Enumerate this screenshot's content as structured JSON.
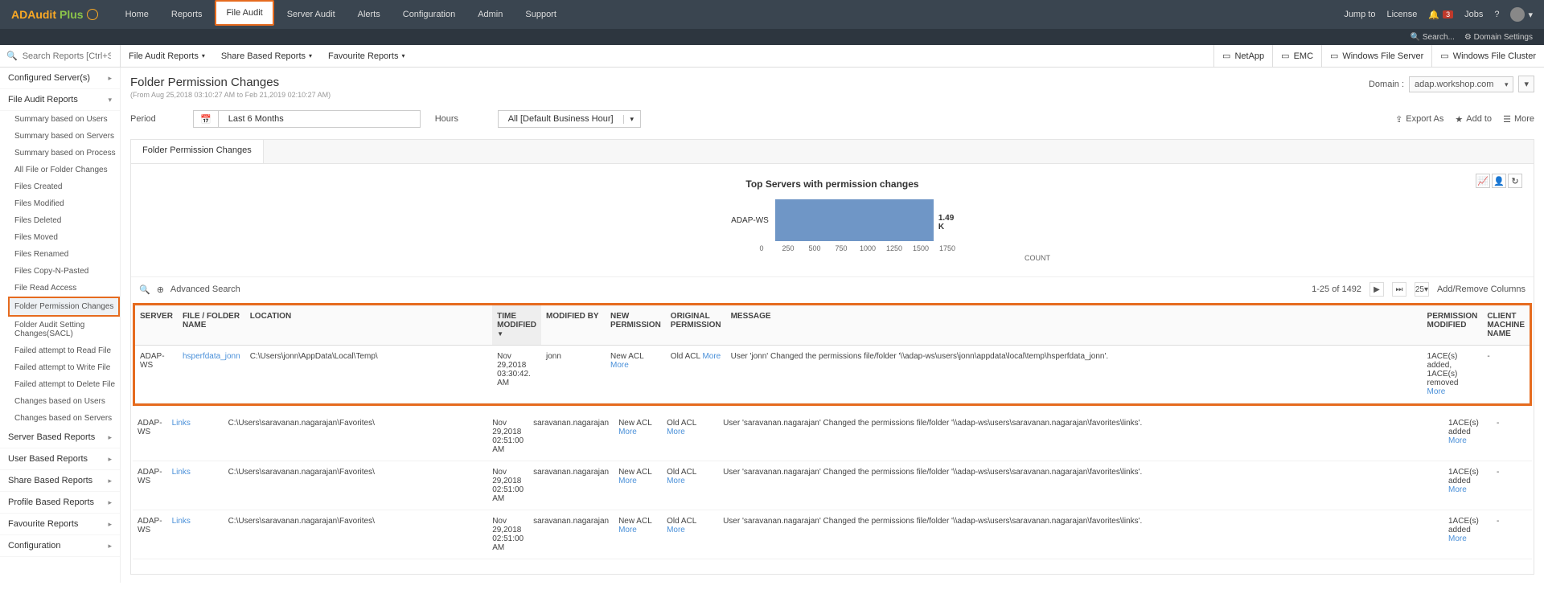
{
  "brand": {
    "p1": "ADAudit",
    "p2": "Plus"
  },
  "topnav": [
    "Home",
    "Reports",
    "File Audit",
    "Server Audit",
    "Alerts",
    "Configuration",
    "Admin",
    "Support"
  ],
  "topnav_active": 2,
  "topright": {
    "jumpto": "Jump to",
    "license": "License",
    "jobs": "Jobs",
    "alerts": "3",
    "search": "Search...",
    "domain_settings": "Domain Settings"
  },
  "second": {
    "search_placeholder": "Search Reports [Ctrl+Space]",
    "subs": [
      "File Audit Reports",
      "Share Based Reports",
      "Favourite Reports"
    ],
    "right": [
      "NetApp",
      "EMC",
      "Windows File Server",
      "Windows File Cluster"
    ]
  },
  "sidebar": {
    "groups": [
      {
        "title": "Configured Server(s)",
        "expand": false
      },
      {
        "title": "File Audit Reports",
        "expand": true,
        "items": [
          "Summary based on Users",
          "Summary based on Servers",
          "Summary based on Process",
          "All File or Folder Changes",
          "Files Created",
          "Files Modified",
          "Files Deleted",
          "Files Moved",
          "Files Renamed",
          "Files Copy-N-Pasted",
          "File Read Access",
          "Folder Permission Changes",
          "Folder Audit Setting Changes(SACL)",
          "Failed attempt to Read File",
          "Failed attempt to Write File",
          "Failed attempt to Delete File",
          "Changes based on Users",
          "Changes based on Servers"
        ],
        "active": 11
      },
      {
        "title": "Server Based Reports",
        "expand": false
      },
      {
        "title": "User Based Reports",
        "expand": false
      },
      {
        "title": "Share Based Reports",
        "expand": false
      },
      {
        "title": "Profile Based Reports",
        "expand": false
      },
      {
        "title": "Favourite Reports",
        "expand": false
      },
      {
        "title": "Configuration",
        "expand": false
      }
    ]
  },
  "page": {
    "title": "Folder Permission Changes",
    "range": "(From Aug 25,2018 03:10:27 AM to Feb 21,2019 02:10:27 AM)",
    "domain_label": "Domain :",
    "domain_value": "adap.workshop.com"
  },
  "filters": {
    "period_lbl": "Period",
    "period_val": "Last 6 Months",
    "hours_lbl": "Hours",
    "hours_val": "All [Default Business Hour]"
  },
  "toolbar": {
    "export": "Export As",
    "addto": "Add to",
    "more": "More"
  },
  "tab": "Folder Permission Changes",
  "chart_data": {
    "type": "bar",
    "title": "Top Servers with permission changes",
    "orientation": "horizontal",
    "categories": [
      "ADAP-WS"
    ],
    "values": [
      1490
    ],
    "value_labels": [
      "1.49 K"
    ],
    "xlabel": "COUNT",
    "x_ticks": [
      0,
      250,
      500,
      750,
      1000,
      1250,
      1500,
      1750
    ]
  },
  "table": {
    "adv": "Advanced Search",
    "count": "1-25 of 1492",
    "pagesize": "25",
    "addrem": "Add/Remove Columns",
    "cols": [
      "SERVER",
      "FILE / FOLDER NAME",
      "LOCATION",
      "TIME MODIFIED",
      "MODIFIED BY",
      "NEW PERMISSION",
      "ORIGINAL PERMISSION",
      "MESSAGE",
      "PERMISSION MODIFIED",
      "CLIENT MACHINE NAME"
    ],
    "sorted_col": 3,
    "rows": [
      {
        "server": "ADAP-WS",
        "file": "hsperfdata_jonn",
        "loc": "C:\\Users\\jonn\\AppData\\Local\\Temp\\",
        "time": "Nov 29,2018 03:30:42. AM",
        "by": "jonn",
        "newp": "New ACL",
        "newp_more": "More",
        "oldp": "Old ACL",
        "oldp_more": "More",
        "msg": "User 'jonn' Changed the permissions file/folder '\\\\adap-ws\\users\\jonn\\appdata\\local\\temp\\hsperfdata_jonn'.",
        "pmod": "1ACE(s) added, 1ACE(s) removed",
        "pmod_more": "More",
        "client": "-"
      },
      {
        "server": "ADAP-WS",
        "file": "Links",
        "loc": "C:\\Users\\saravanan.nagarajan\\Favorites\\",
        "time": "Nov 29,2018 02:51:00 AM",
        "by": "saravanan.nagarajan",
        "newp": "New ACL",
        "newp_more": "More",
        "oldp": "Old ACL",
        "oldp_more": "More",
        "msg": "User 'saravanan.nagarajan' Changed the permissions file/folder '\\\\adap-ws\\users\\saravanan.nagarajan\\favorites\\links'.",
        "pmod": "1ACE(s) added",
        "pmod_more": "More",
        "client": "-"
      },
      {
        "server": "ADAP-WS",
        "file": "Links",
        "loc": "C:\\Users\\saravanan.nagarajan\\Favorites\\",
        "time": "Nov 29,2018 02:51:00 AM",
        "by": "saravanan.nagarajan",
        "newp": "New ACL",
        "newp_more": "More",
        "oldp": "Old ACL",
        "oldp_more": "More",
        "msg": "User 'saravanan.nagarajan' Changed the permissions file/folder '\\\\adap-ws\\users\\saravanan.nagarajan\\favorites\\links'.",
        "pmod": "1ACE(s) added",
        "pmod_more": "More",
        "client": "-"
      },
      {
        "server": "ADAP-WS",
        "file": "Links",
        "loc": "C:\\Users\\saravanan.nagarajan\\Favorites\\",
        "time": "Nov 29,2018 02:51:00 AM",
        "by": "saravanan.nagarajan",
        "newp": "New ACL",
        "newp_more": "More",
        "oldp": "Old ACL",
        "oldp_more": "More",
        "msg": "User 'saravanan.nagarajan' Changed the permissions file/folder '\\\\adap-ws\\users\\saravanan.nagarajan\\favorites\\links'.",
        "pmod": "1ACE(s) added",
        "pmod_more": "More",
        "client": "-"
      }
    ]
  }
}
